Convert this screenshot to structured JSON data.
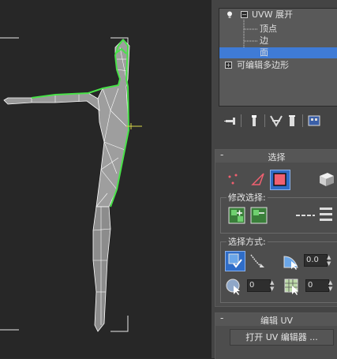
{
  "modifier_stack": {
    "items": [
      {
        "label": "UVW 展开",
        "type": "modifier"
      },
      {
        "label": "顶点",
        "type": "sub"
      },
      {
        "label": "边",
        "type": "sub"
      },
      {
        "label": "面",
        "type": "sub",
        "selected": true
      },
      {
        "label": "可编辑多边形",
        "type": "base"
      }
    ]
  },
  "selection_rollout": {
    "title": "选择",
    "modify_selection_label": "修改选择:",
    "selection_method_label": "选择方式:",
    "angle_value": "0.0",
    "spin1_value": "0",
    "spin2_value": "0"
  },
  "edit_uv_rollout": {
    "title": "编辑 UV",
    "open_editor_label": "打开 UV 编辑器 ..."
  },
  "colors": {
    "selection_blue": "#3f7bd6",
    "seam_green": "#49e249",
    "face_red": "#f06070"
  }
}
